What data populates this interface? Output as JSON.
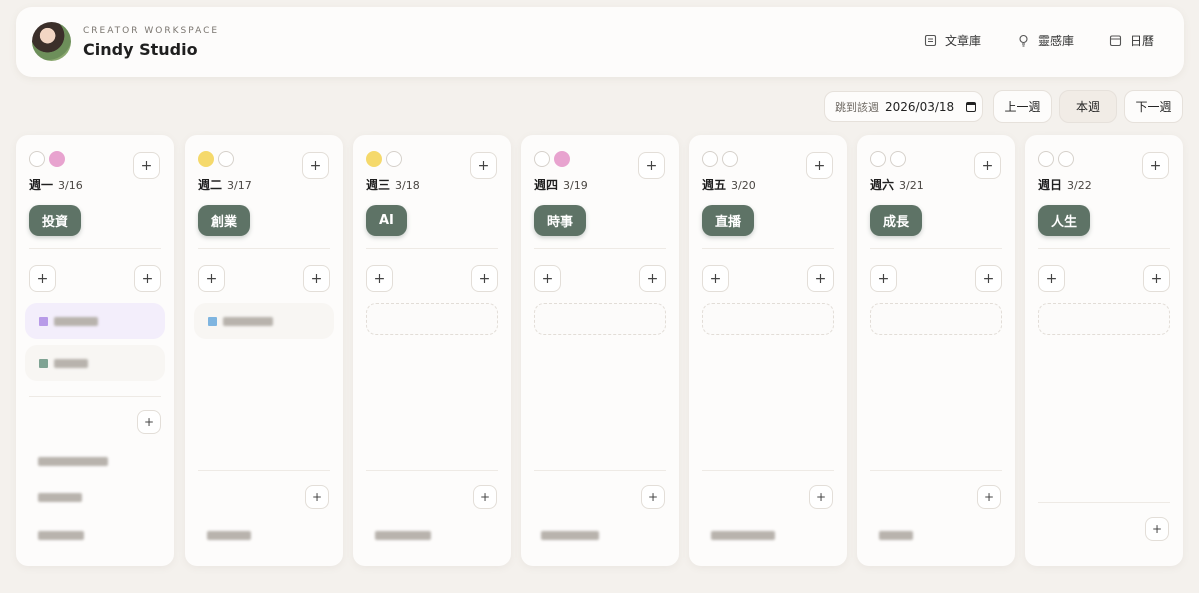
{
  "header": {
    "workspace_label": "CREATOR WORKSPACE",
    "studio_name": "Cindy Studio",
    "nav": [
      {
        "label": "文章庫",
        "icon": "document-icon"
      },
      {
        "label": "靈感庫",
        "icon": "lightbulb-icon"
      },
      {
        "label": "日曆",
        "icon": "calendar-icon"
      }
    ]
  },
  "toolbar": {
    "jump_label": "跳到該週",
    "date_value": "2026/03/18",
    "prev_week": "上一週",
    "this_week": "本週",
    "next_week": "下一週"
  },
  "colors": {
    "tag_bg": "#5e7366",
    "dot_yellow": "#f5d96b",
    "dot_pink": "#e8a3cf",
    "card_purple": "#f3eefb",
    "card_purple_square": "#b89be8",
    "card_green_square": "#7fa393",
    "card_blue_square": "#7fb5e0"
  },
  "days": [
    {
      "name": "週一",
      "date": "3/16",
      "tag": "投資",
      "dots": [
        "empty",
        "pink"
      ]
    },
    {
      "name": "週二",
      "date": "3/17",
      "tag": "創業",
      "dots": [
        "yellow",
        "empty"
      ]
    },
    {
      "name": "週三",
      "date": "3/18",
      "tag": "AI",
      "dots": [
        "yellow",
        "empty"
      ]
    },
    {
      "name": "週四",
      "date": "3/19",
      "tag": "時事",
      "dots": [
        "empty",
        "pink"
      ]
    },
    {
      "name": "週五",
      "date": "3/20",
      "tag": "直播",
      "dots": [
        "empty",
        "empty"
      ]
    },
    {
      "name": "週六",
      "date": "3/21",
      "tag": "成長",
      "dots": [
        "empty",
        "empty"
      ]
    },
    {
      "name": "週日",
      "date": "3/22",
      "tag": "人生",
      "dots": [
        "empty",
        "empty"
      ]
    }
  ]
}
